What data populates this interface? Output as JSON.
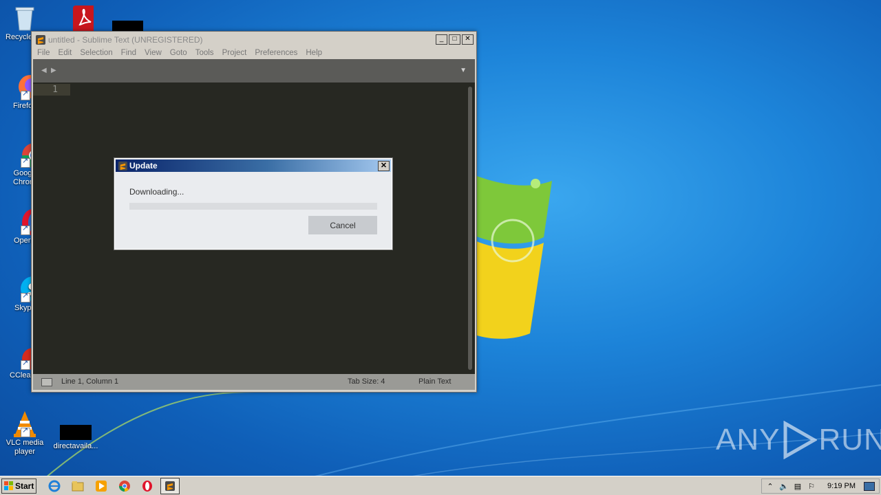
{
  "desktop": {
    "icons": [
      {
        "label": "Recycle Bin"
      },
      {
        "label": "Acrobat Reader DC"
      },
      {
        "label": "Firefox"
      },
      {
        "label": "Google Chrome"
      },
      {
        "label": "Opera"
      },
      {
        "label": "Skype"
      },
      {
        "label": "CCleaner"
      },
      {
        "label": "VLC media player"
      },
      {
        "label": "directavaila..."
      }
    ],
    "watermark_left": "ANY",
    "watermark_right": "RUN"
  },
  "sublime": {
    "title": "untitled - Sublime Text (UNREGISTERED)",
    "menu": [
      "File",
      "Edit",
      "Selection",
      "Find",
      "View",
      "Goto",
      "Tools",
      "Project",
      "Preferences",
      "Help"
    ],
    "gutter_line": "1",
    "status": {
      "position": "Line 1, Column 1",
      "tab_size": "Tab Size: 4",
      "syntax": "Plain Text"
    }
  },
  "dialog": {
    "title": "Update",
    "message": "Downloading...",
    "progress": 0,
    "cancel_label": "Cancel"
  },
  "taskbar": {
    "start_label": "Start",
    "clock": "9:19 PM"
  },
  "colors": {
    "editor_bg": "#272822",
    "dialog_title_start": "#0a246a",
    "dialog_title_end": "#a6caf0",
    "desktop_blue": "#1d84d9"
  }
}
